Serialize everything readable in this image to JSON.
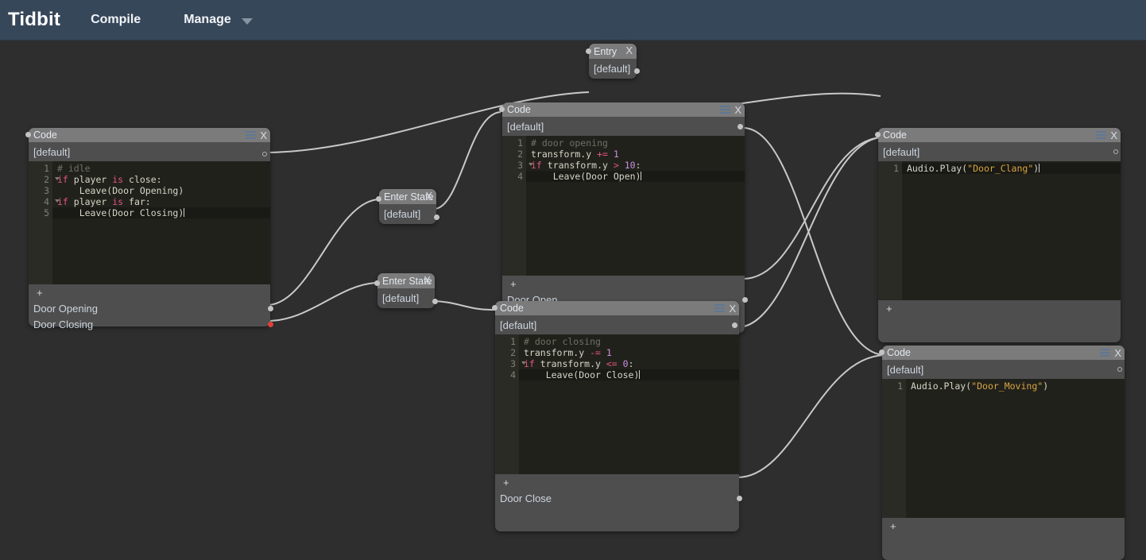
{
  "app": {
    "brand": "Tidbit",
    "menus": [
      {
        "label": "Compile"
      },
      {
        "label": "Manage"
      }
    ],
    "caret_icon": "chevron-down-icon"
  },
  "colors": {
    "topbar_bg": "#37475a",
    "canvas_bg": "#2e2e2e",
    "node_bg": "#4e4e4e",
    "node_title_bg": "#7b7b7b",
    "editor_bg": "#21211c",
    "gutter_bg": "#2b2b26",
    "wire": "#c8c8c8",
    "port_filled": "#c3c3c3",
    "port_red": "#e0403a",
    "hamburger": "#5f7795",
    "string": "#d9a441",
    "keyword": "#e0557f",
    "number": "#c98fe0",
    "comment": "#6f7063"
  },
  "nodes": {
    "entry": {
      "title": "Entry",
      "close_label": "X",
      "default_label": "[default]"
    },
    "idle": {
      "title": "Code",
      "close_label": "X",
      "default_label": "[default]",
      "plus_label": "+",
      "lines": [
        {
          "n": "1",
          "fold": false,
          "text": "# idle"
        },
        {
          "n": "2",
          "fold": true,
          "text": "if player is close:"
        },
        {
          "n": "3",
          "fold": false,
          "text": "    Leave(Door Opening)"
        },
        {
          "n": "4",
          "fold": true,
          "text": "if player is far:"
        },
        {
          "n": "5",
          "fold": false,
          "text": "    Leave(Door Closing)"
        }
      ],
      "outputs": [
        {
          "label": "Door Opening",
          "port": "filled"
        },
        {
          "label": "Door Closing",
          "port": "red"
        }
      ]
    },
    "enter_state_1": {
      "title": "Enter State",
      "close_label": "X",
      "default_label": "[default]"
    },
    "enter_state_2": {
      "title": "Enter State",
      "close_label": "X",
      "default_label": "[default]"
    },
    "door_open": {
      "title": "Code",
      "close_label": "X",
      "default_label": "[default]",
      "plus_label": "+",
      "lines": [
        {
          "n": "1",
          "fold": false,
          "text": "# door opening"
        },
        {
          "n": "2",
          "fold": false,
          "text": "transform.y += 1"
        },
        {
          "n": "3",
          "fold": true,
          "text": "if transform.y > 10:"
        },
        {
          "n": "4",
          "fold": false,
          "text": "    Leave(Door Open)"
        }
      ],
      "outputs": [
        {
          "label": "Door Open",
          "port": "filled"
        }
      ]
    },
    "door_close": {
      "title": "Code",
      "close_label": "X",
      "default_label": "[default]",
      "plus_label": "+",
      "lines": [
        {
          "n": "1",
          "fold": false,
          "text": "# door closing"
        },
        {
          "n": "2",
          "fold": false,
          "text": "transform.y -= 1"
        },
        {
          "n": "3",
          "fold": true,
          "text": "if transform.y <= 0:"
        },
        {
          "n": "4",
          "fold": false,
          "text": "    Leave(Door Close)"
        }
      ],
      "outputs": [
        {
          "label": "Door Close",
          "port": "filled"
        }
      ]
    },
    "clang": {
      "title": "Code",
      "close_label": "X",
      "default_label": "[default]",
      "plus_label": "+",
      "lines": [
        {
          "n": "1",
          "fold": false,
          "text": "Audio.Play(\"Door_Clang\")"
        }
      ]
    },
    "moving": {
      "title": "Code",
      "close_label": "X",
      "default_label": "[default]",
      "plus_label": "+",
      "lines": [
        {
          "n": "1",
          "fold": false,
          "text": "Audio.Play(\"Door_Moving\")"
        }
      ]
    }
  }
}
